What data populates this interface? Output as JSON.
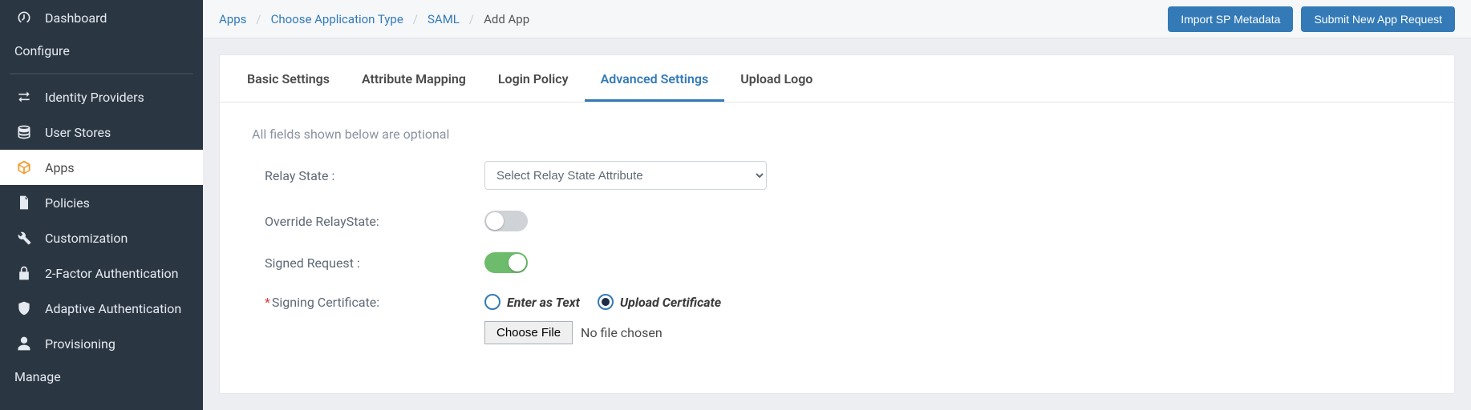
{
  "sidebar": {
    "items": [
      {
        "icon": "dashboard-icon",
        "label": "Dashboard",
        "active": false
      },
      {
        "icon": null,
        "label": "Configure",
        "section": true
      }
    ],
    "config_items": [
      {
        "icon": "swap-icon",
        "label": "Identity Providers"
      },
      {
        "icon": "database-icon",
        "label": "User Stores"
      },
      {
        "icon": "cube-icon",
        "label": "Apps",
        "active": true
      },
      {
        "icon": "file-icon",
        "label": "Policies"
      },
      {
        "icon": "wrench-icon",
        "label": "Customization"
      },
      {
        "icon": "lock-icon",
        "label": "2-Factor Authentication"
      },
      {
        "icon": "shield-icon",
        "label": "Adaptive Authentication"
      },
      {
        "icon": "user-icon",
        "label": "Provisioning"
      },
      {
        "icon": null,
        "label": "Manage",
        "section": true
      }
    ]
  },
  "breadcrumb": {
    "items": [
      {
        "label": "Apps",
        "link": true
      },
      {
        "label": "Choose Application Type",
        "link": true
      },
      {
        "label": "SAML",
        "link": true
      },
      {
        "label": "Add App",
        "link": false
      }
    ]
  },
  "top_actions": {
    "import": "Import SP Metadata",
    "submit": "Submit New App Request"
  },
  "tabs": [
    {
      "label": "Basic Settings",
      "active": false
    },
    {
      "label": "Attribute Mapping",
      "active": false
    },
    {
      "label": "Login Policy",
      "active": false
    },
    {
      "label": "Advanced Settings",
      "active": true
    },
    {
      "label": "Upload Logo",
      "active": false
    }
  ],
  "form": {
    "hint": "All fields shown below are optional",
    "relay_label": "Relay State :",
    "relay_selected": "Select Relay State Attribute",
    "override_label": "Override RelayState:",
    "override_on": false,
    "signed_label": "Signed Request :",
    "signed_on": true,
    "cert_label": "Signing Certificate:",
    "cert_options": {
      "enter_text": "Enter as Text",
      "upload": "Upload Certificate",
      "selected": "upload"
    },
    "file": {
      "button": "Choose File",
      "status": "No file chosen"
    }
  }
}
